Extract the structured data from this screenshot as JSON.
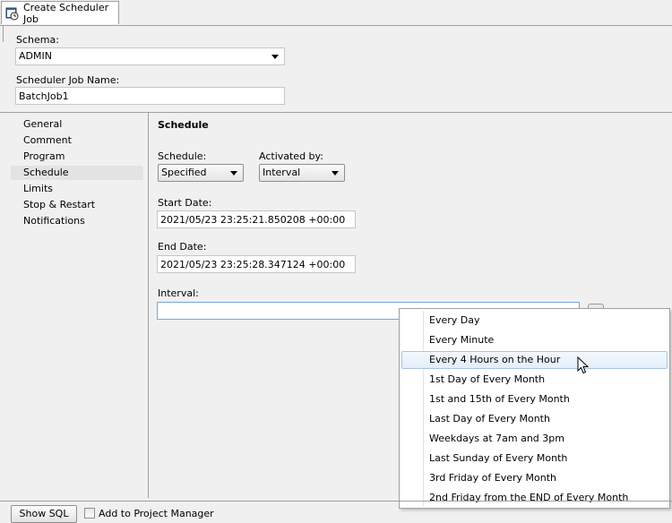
{
  "tab": {
    "title": "Create Scheduler Job",
    "icon": "scheduler-job-icon"
  },
  "schema": {
    "label": "Schema:",
    "value": "ADMIN"
  },
  "job_name": {
    "label": "Scheduler Job Name:",
    "value": "BatchJob1"
  },
  "nav": {
    "items": [
      {
        "label": "General"
      },
      {
        "label": "Comment"
      },
      {
        "label": "Program"
      },
      {
        "label": "Schedule",
        "selected": true
      },
      {
        "label": "Limits"
      },
      {
        "label": "Stop & Restart"
      },
      {
        "label": "Notifications"
      }
    ]
  },
  "schedule": {
    "title": "Schedule",
    "schedule_label": "Schedule:",
    "schedule_value": "Specified",
    "activated_label": "Activated by:",
    "activated_value": "Interval",
    "start_label": "Start Date:",
    "start_value": "2021/05/23 23:25:21.850208 +00:00",
    "end_label": "End Date:",
    "end_value": "2021/05/23 23:25:28.347124 +00:00",
    "interval_label": "Interval:",
    "interval_value": ""
  },
  "interval_menu": {
    "items": [
      "Every Day",
      "Every Minute",
      "Every 4 Hours on the Hour",
      "1st Day of Every Month",
      "1st and 15th of Every Month",
      "Last Day of Every Month",
      "Weekdays at 7am and 3pm",
      "Last Sunday of Every Month",
      "3rd Friday of Every Month",
      "2nd Friday from the END of Every Month"
    ],
    "highlighted_index": 2
  },
  "footer": {
    "show_sql_label": "Show SQL",
    "add_to_pm_label": "Add to Project Manager",
    "add_to_pm_checked": false
  }
}
